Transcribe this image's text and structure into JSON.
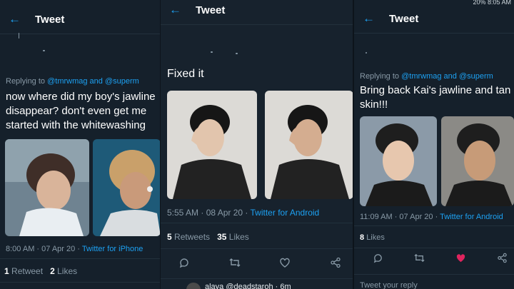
{
  "p1": {
    "header": {
      "back": "←",
      "title": "Tweet"
    },
    "replying_prefix": "Replying to",
    "replying_to": "@tmrwmag and @superm",
    "text": "now where did my boy's jawline disappear? don't even get me started with the whitewashing",
    "meta": {
      "time": "8:00 AM · 07 Apr 20 · ",
      "source": "Twitter for iPhone"
    },
    "stats": {
      "retweets_count": "1",
      "retweets_label": "Retweet",
      "likes_count": "2",
      "likes_label": "Likes"
    }
  },
  "p2": {
    "header": {
      "back": "←",
      "title": "Tweet"
    },
    "text": "Fixed it",
    "meta": {
      "time": "5:55 AM · 08 Apr 20 · ",
      "source": "Twitter for Android"
    },
    "stats": {
      "retweets_count": "5",
      "retweets_label": "Retweets",
      "likes_count": "35",
      "likes_label": "Likes"
    },
    "reply_preview": "alaya @deadstaroh · 6m"
  },
  "p3": {
    "header": {
      "back": "←",
      "title": "Tweet"
    },
    "status_time": "20% 8:05 AM",
    "replying_prefix": "Replying to",
    "replying_to": "@tmrwmag and @superm",
    "text": "Bring back Kai's jawline and tan skin!!!",
    "meta": {
      "time": "11:09 AM · 07 Apr 20 · ",
      "source": "Twitter for Android"
    },
    "stats": {
      "likes_count": "8",
      "likes_label": "Likes"
    },
    "reply_placeholder": "Tweet your reply"
  },
  "icons": {
    "reply": "reply-icon",
    "retweet": "retweet-icon",
    "like": "heart-icon",
    "share": "share-icon"
  },
  "colors": {
    "background": "#15202b",
    "accent": "#1da1f2",
    "muted": "#8899a6",
    "liked": "#e0245e"
  }
}
